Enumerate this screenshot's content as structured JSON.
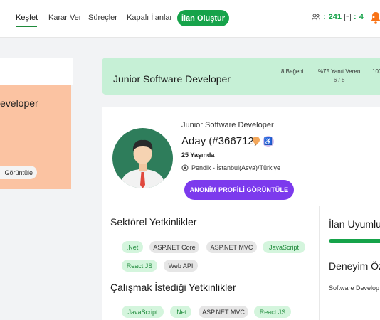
{
  "nav": {
    "items": [
      "Keşfet",
      "Karar Ver",
      "Süreçler",
      "Kapalı İlanlar"
    ],
    "create_button": "İlan Oluştur",
    "stats": {
      "users": "241",
      "docs": "4"
    }
  },
  "left": {
    "title": "eveloper",
    "button": "Görüntüle"
  },
  "job": {
    "title": "Junior Software Developer",
    "likes": "8 Beğeni",
    "response_label": "%75 Yanıt Veren",
    "response_sub": "6 / 8",
    "third_stat": "100"
  },
  "candidate": {
    "role": "Junior Software Developer",
    "name": "Aday (#366712)",
    "age": "25 Yaşında",
    "location": "Pendik - İstanbul(Asya)/Türkiye",
    "profile_button": "ANONİM PROFİLİ GÖRÜNTÜLE"
  },
  "sectoral": {
    "title": "Sektörel Yetkinlikler",
    "tags": [
      ".Net",
      "ASP.NET Core",
      "ASP.NET MVC",
      "JavaScript",
      "React JS",
      "Web API"
    ]
  },
  "desired": {
    "title": "Çalışmak İstediği Yetkinlikler",
    "tags": [
      "JavaScript",
      ".Net",
      "ASP.NET MVC",
      "React JS"
    ]
  },
  "side": {
    "fit_title": "İlan Uyumlu",
    "exp_title": "Deneyim Öz",
    "exp_item": "Software Develop"
  },
  "colors": {
    "accent_green": "#16a34a",
    "header_green": "#c6f0d6",
    "purple": "#7c3aed",
    "peach": "#fbc3a2"
  }
}
